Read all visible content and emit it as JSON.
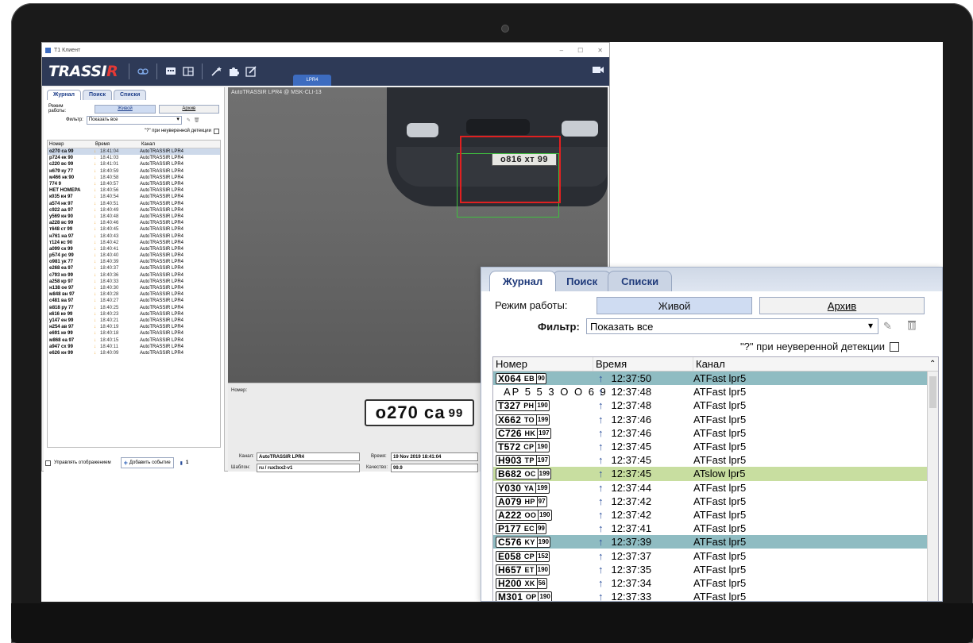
{
  "window": {
    "title": "T1 Клиент"
  },
  "toolbar": {
    "logo_main": "TRASSI",
    "logo_r": "R",
    "tab_label": "LPR4"
  },
  "left": {
    "tabs": [
      "Журнал",
      "Поиск",
      "Списки"
    ],
    "mode_label": "Режим работы:",
    "live": "Живой",
    "archive": "Архив",
    "filter_label": "Фильтр:",
    "filter_value": "Показать все",
    "uncertain": "\"?\" при неуверенной детекции",
    "headers": [
      "Номер",
      "Время",
      "Канал"
    ],
    "rows": [
      {
        "num": "о270 са 99",
        "time": "18:41:04",
        "chan": "AutoTRASSIR LPR4"
      },
      {
        "num": "р724 ек 90",
        "time": "18:41:03",
        "chan": "AutoTRASSIR LPR4"
      },
      {
        "num": "с220 вс 99",
        "time": "18:41:01",
        "chan": "AutoTRASSIR LPR4"
      },
      {
        "num": "н679 ку 77",
        "time": "18:40:59",
        "chan": "AutoTRASSIR LPR4"
      },
      {
        "num": "м466 нк 90",
        "time": "18:40:58",
        "chan": "AutoTRASSIR LPR4"
      },
      {
        "num": "774 9",
        "time": "18:40:57",
        "chan": "AutoTRASSIR LPR4"
      },
      {
        "num": "НЕТ НОМЕРА",
        "time": "18:40:56",
        "chan": "AutoTRASSIR LPR4"
      },
      {
        "num": "к035 кн 97",
        "time": "18:40:54",
        "chan": "AutoTRASSIR LPR4"
      },
      {
        "num": "а574 нк 97",
        "time": "18:40:51",
        "chan": "AutoTRASSIR LPR4"
      },
      {
        "num": "с922 аа 97",
        "time": "18:40:49",
        "chan": "AutoTRASSIR LPR4"
      },
      {
        "num": "у569 кн 90",
        "time": "18:40:48",
        "chan": "AutoTRASSIR LPR4"
      },
      {
        "num": "а228 вс 99",
        "time": "18:40:46",
        "chan": "AutoTRASSIR LPR4"
      },
      {
        "num": "т648 ст 99",
        "time": "18:40:45",
        "chan": "AutoTRASSIR LPR4"
      },
      {
        "num": "н761 на 97",
        "time": "18:40:43",
        "chan": "AutoTRASSIR LPR4"
      },
      {
        "num": "т124 кс 90",
        "time": "18:40:42",
        "chan": "AutoTRASSIR LPR4"
      },
      {
        "num": "а099 ск 99",
        "time": "18:40:41",
        "chan": "AutoTRASSIR LPR4"
      },
      {
        "num": "р574 рс 99",
        "time": "18:40:40",
        "chan": "AutoTRASSIR LPR4"
      },
      {
        "num": "о981 ук 77",
        "time": "18:40:39",
        "chan": "AutoTRASSIR LPR4"
      },
      {
        "num": "е268 еа 97",
        "time": "18:40:37",
        "chan": "AutoTRASSIR LPR4"
      },
      {
        "num": "с793 ко 99",
        "time": "18:40:36",
        "chan": "AutoTRASSIR LPR4"
      },
      {
        "num": "а258 кр 97",
        "time": "18:40:33",
        "chan": "AutoTRASSIR LPR4"
      },
      {
        "num": "н138 ое 97",
        "time": "18:40:30",
        "chan": "AutoTRASSIR LPR4"
      },
      {
        "num": "м848 вн 97",
        "time": "18:40:28",
        "chan": "AutoTRASSIR LPR4"
      },
      {
        "num": "с481 ва 97",
        "time": "18:40:27",
        "chan": "AutoTRASSIR LPR4"
      },
      {
        "num": "в818 ру 77",
        "time": "18:40:25",
        "chan": "AutoTRASSIR LPR4"
      },
      {
        "num": "к616 ке 99",
        "time": "18:40:23",
        "chan": "AutoTRASSIR LPR4"
      },
      {
        "num": "у147 ен 99",
        "time": "18:40:21",
        "chan": "AutoTRASSIR LPR4"
      },
      {
        "num": "н254 ав 97",
        "time": "18:40:19",
        "chan": "AutoTRASSIR LPR4"
      },
      {
        "num": "е691 ке 99",
        "time": "18:40:18",
        "chan": "AutoTRASSIR LPR4"
      },
      {
        "num": "м868 еа 97",
        "time": "18:40:15",
        "chan": "AutoTRASSIR LPR4"
      },
      {
        "num": "а947 сх 99",
        "time": "18:40:11",
        "chan": "AutoTRASSIR LPR4"
      },
      {
        "num": "е626 кн 99",
        "time": "18:40:09",
        "chan": "AutoTRASSIR LPR4"
      }
    ],
    "footer_manage": "Управлять отображением",
    "footer_add": "Добавить событие",
    "footer_count": "1"
  },
  "video": {
    "label": "AutoTRASSIR LPR4 @ MSK-CLI-13",
    "plate_in_frame": "о816 хт 99"
  },
  "info": {
    "number_label": "Номер:",
    "plate_main": "о270 са",
    "plate_region": "99",
    "channel_label": "Канал:",
    "channel_value": "AutoTRASSIR LPR4",
    "time_label": "Время:",
    "time_value": "19 Nov 2019 18:41:04",
    "template_label": "Шаблон:",
    "template_value": "ru / rux3xx2-v1",
    "quality_label": "Качество:",
    "quality_value": "99.9"
  },
  "zoom": {
    "tabs": [
      "Журнал",
      "Поиск",
      "Списки"
    ],
    "mode_label": "Режим работы:",
    "live": "Живой",
    "archive": "Архив",
    "filter_label": "Фильтр:",
    "filter_value": "Показать все",
    "uncertain": "\"?\" при неуверенной детекции",
    "headers": [
      "Номер",
      "Время",
      "Канал"
    ],
    "rows": [
      {
        "type": "plate",
        "main": "X064",
        "tail": "EB",
        "region": "90",
        "time": "12:37:50",
        "chan": "ATFast lpr5",
        "hl": "teal"
      },
      {
        "type": "plain",
        "text": "AP 5 5 3 O O 6 9",
        "time": "12:37:48",
        "chan": "ATFast lpr5",
        "hl": ""
      },
      {
        "type": "plate",
        "main": "T327",
        "tail": "PH",
        "region": "190",
        "time": "12:37:48",
        "chan": "ATFast lpr5",
        "hl": ""
      },
      {
        "type": "plate",
        "main": "X662",
        "tail": "TO",
        "region": "199",
        "time": "12:37:46",
        "chan": "ATFast lpr5",
        "hl": ""
      },
      {
        "type": "plate",
        "main": "C726",
        "tail": "HK",
        "region": "197",
        "time": "12:37:46",
        "chan": "ATFast lpr5",
        "hl": ""
      },
      {
        "type": "plate",
        "main": "T572",
        "tail": "CP",
        "region": "190",
        "time": "12:37:45",
        "chan": "ATFast lpr5",
        "hl": ""
      },
      {
        "type": "plate",
        "main": "H903",
        "tail": "TP",
        "region": "197",
        "time": "12:37:45",
        "chan": "ATFast lpr5",
        "hl": ""
      },
      {
        "type": "plate",
        "main": "B682",
        "tail": "OC",
        "region": "199",
        "time": "12:37:45",
        "chan": "ATslow lpr5",
        "hl": "green"
      },
      {
        "type": "plate",
        "main": "Y030",
        "tail": "YA",
        "region": "199",
        "time": "12:37:44",
        "chan": "ATFast lpr5",
        "hl": ""
      },
      {
        "type": "plate",
        "main": "A079",
        "tail": "HP",
        "region": "97",
        "time": "12:37:42",
        "chan": "ATFast lpr5",
        "hl": ""
      },
      {
        "type": "plate",
        "main": "A222",
        "tail": "OO",
        "region": "190",
        "time": "12:37:42",
        "chan": "ATFast lpr5",
        "hl": ""
      },
      {
        "type": "plate",
        "main": "P177",
        "tail": "EC",
        "region": "99",
        "time": "12:37:41",
        "chan": "ATFast lpr5",
        "hl": ""
      },
      {
        "type": "plate",
        "main": "C576",
        "tail": "KY",
        "region": "190",
        "time": "12:37:39",
        "chan": "ATFast lpr5",
        "hl": "teal"
      },
      {
        "type": "plate",
        "main": "E058",
        "tail": "CP",
        "region": "152",
        "time": "12:37:37",
        "chan": "ATFast lpr5",
        "hl": ""
      },
      {
        "type": "plate",
        "main": "H657",
        "tail": "ET",
        "region": "190",
        "time": "12:37:35",
        "chan": "ATFast lpr5",
        "hl": ""
      },
      {
        "type": "plate",
        "main": "H200",
        "tail": "XK",
        "region": "56",
        "time": "12:37:34",
        "chan": "ATFast lpr5",
        "hl": ""
      },
      {
        "type": "plate",
        "main": "M301",
        "tail": "OP",
        "region": "190",
        "time": "12:37:33",
        "chan": "ATFast lpr5",
        "hl": ""
      }
    ]
  },
  "colors": {
    "toolbar": "#2e3a57",
    "accent_blue": "#3d6cc0",
    "logo_red": "#e53935",
    "row_teal": "#8fbcc2",
    "row_green": "#c8dea0",
    "box_red": "#e02020",
    "box_green": "#3fbf3f",
    "arrow_orange": "#f0a020"
  }
}
